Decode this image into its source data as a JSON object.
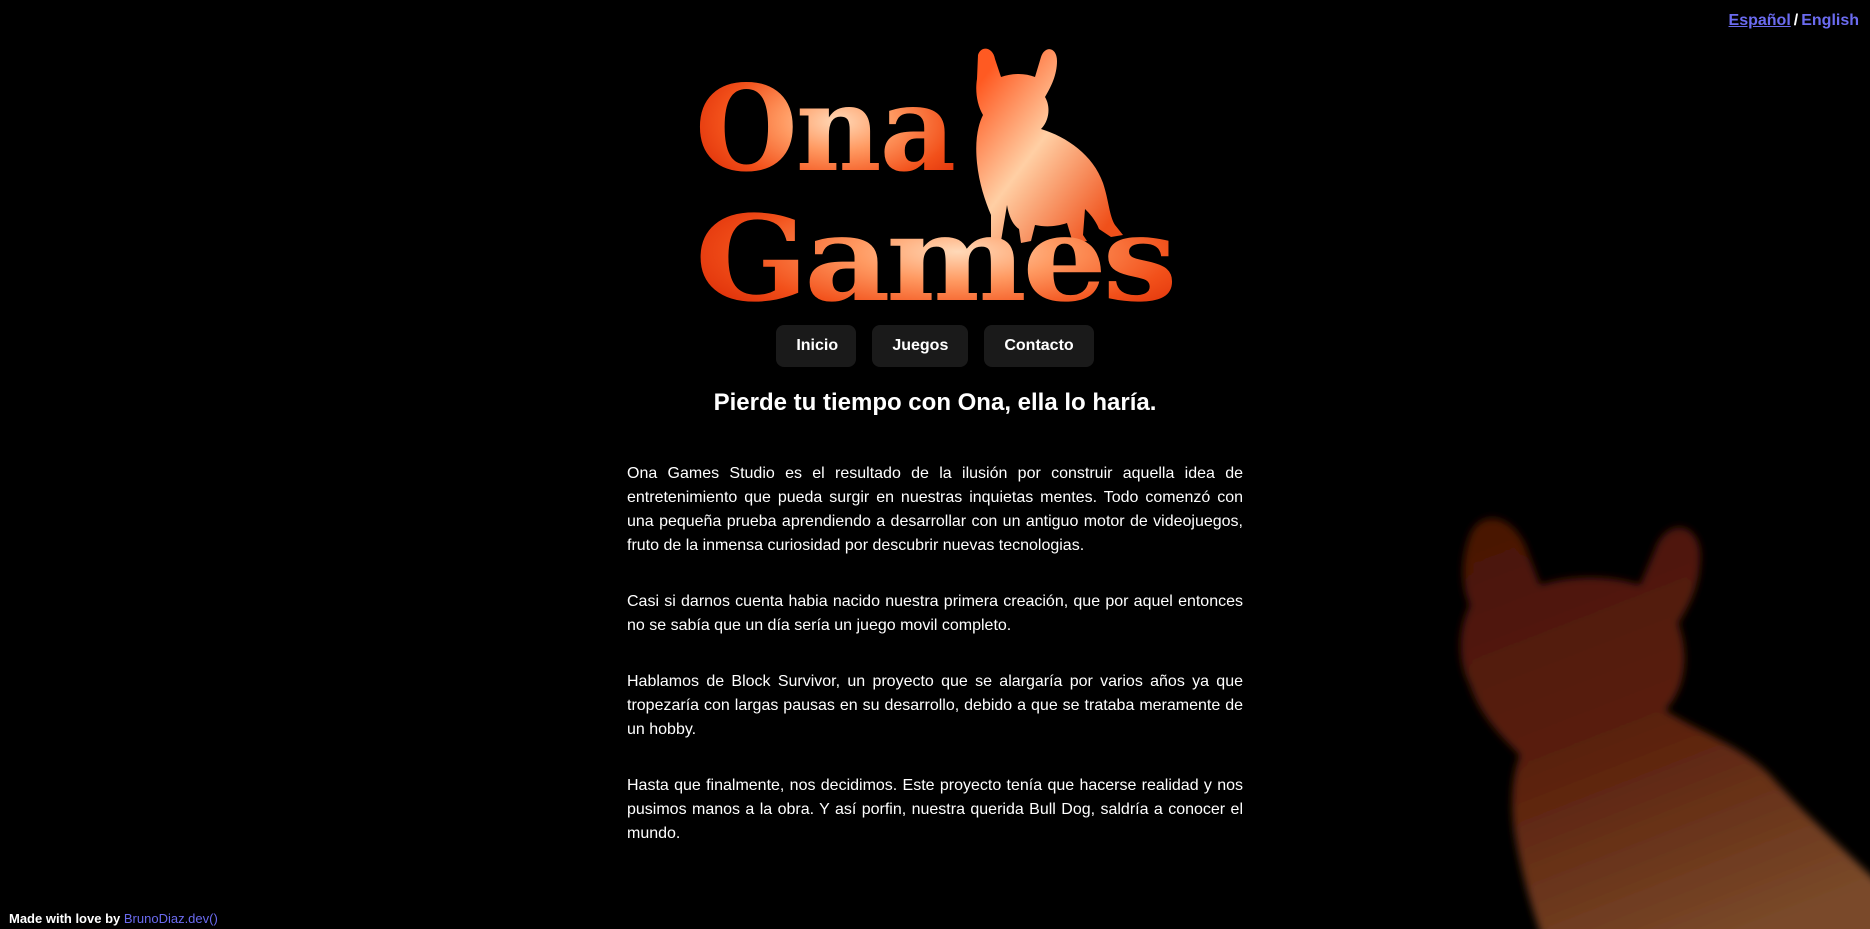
{
  "lang": {
    "es_label": "Español",
    "separator": "/",
    "en_label": "English"
  },
  "logo": {
    "line1": "Ona",
    "line2": "Games"
  },
  "nav": {
    "items": [
      {
        "label": "Inicio"
      },
      {
        "label": "Juegos"
      },
      {
        "label": "Contacto"
      }
    ]
  },
  "headline": "Pierde tu tiempo con Ona, ella lo haría.",
  "paragraphs": [
    "Ona Games Studio es el resultado de la ilusión por construir aquella idea de entretenimiento que pueda surgir en nuestras inquietas mentes. Todo comenzó con una pequeña prueba aprendiendo a desarrollar con un antiguo motor de videojuegos, fruto de la inmensa curiosidad por descubrir nuevas tecnologias.",
    "Casi si darnos cuenta habia nacido nuestra primera creación, que por aquel entonces no se sabía que un día sería un juego movil completo.",
    "Hablamos de Block Survivor, un proyecto que se alargaría por varios años ya que tropezaría con largas pausas en su desarrollo, debido a que se trataba meramente de un hobby.",
    "Hasta que finalmente, nos decidimos. Este proyecto tenía que hacerse realidad y nos pusimos manos a la obra. Y así porfin, nuestra querida Bull Dog, saldría a conocer el mundo."
  ],
  "footer": {
    "text": "Made with love by",
    "link": "BrunoDiaz.dev()"
  },
  "colors": {
    "background": "#000000",
    "link": "#6b6bf0",
    "button_bg": "#1a1a1a",
    "logo_dark": "#f03a0c",
    "logo_light": "#ffd2a8"
  }
}
